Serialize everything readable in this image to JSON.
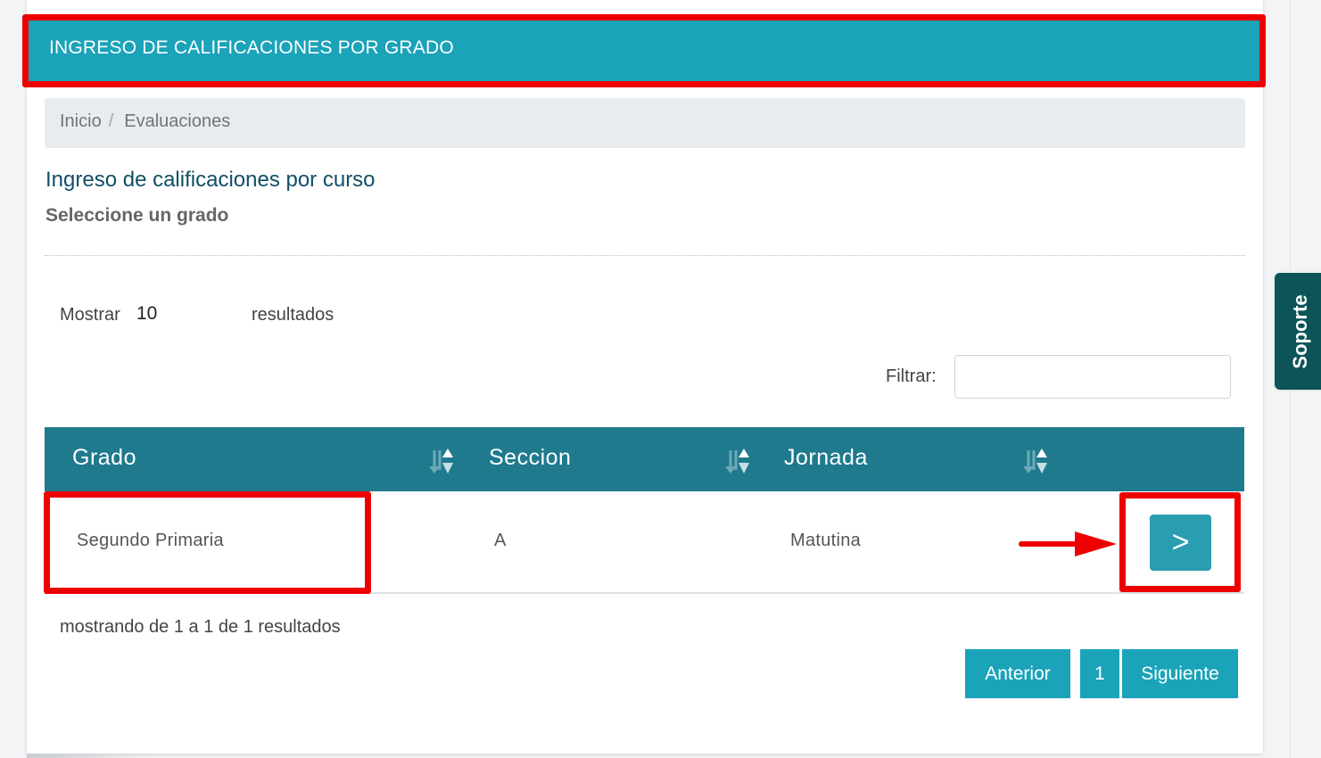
{
  "header": {
    "title": "INGRESO DE CALIFICACIONES POR GRADO"
  },
  "breadcrumb": {
    "items": [
      "Inicio",
      "Evaluaciones"
    ],
    "separator": "/"
  },
  "page": {
    "title": "Ingreso de calificaciones por curso",
    "subtitle": "Seleccione un grado"
  },
  "length": {
    "label": "Mostrar",
    "value": "10",
    "suffix": "resultados"
  },
  "filter": {
    "label": "Filtrar:",
    "value": ""
  },
  "table": {
    "columns": [
      "Grado",
      "Seccion",
      "Jornada"
    ],
    "rows": [
      {
        "grado": "Segundo Primaria",
        "seccion": "A",
        "jornada": "Matutina",
        "action": ">"
      }
    ]
  },
  "info": "mostrando de 1 a 1 de 1 resultados",
  "pagination": {
    "prev": "Anterior",
    "page": "1",
    "next": "Siguiente"
  },
  "support_tab": "Soporte",
  "colors": {
    "header": "#1aa3b9",
    "table_head": "#1f7a8e",
    "button": "#2a9db0",
    "annotation": "#ee0000",
    "support": "#0d5459"
  },
  "icons": [
    "sort-icon",
    "arrow-right-icon"
  ]
}
